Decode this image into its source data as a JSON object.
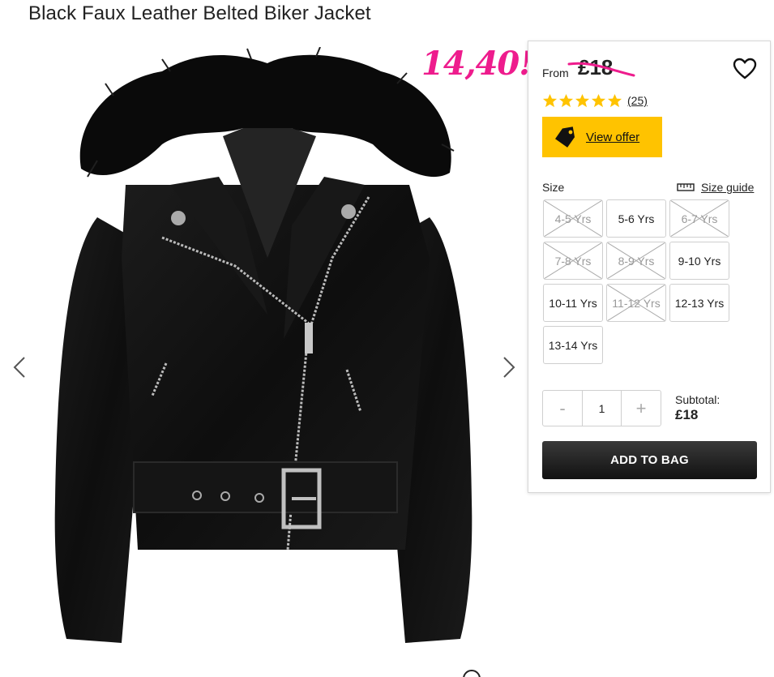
{
  "product": {
    "title": "Black Faux Leather Belted Biker Jacket"
  },
  "promo": {
    "handwritten_price": "14,40!",
    "color": "#ee1c8d"
  },
  "price": {
    "from_label": "From",
    "original": "£18"
  },
  "rating": {
    "stars": 5,
    "count_label": "(25)",
    "star_color": "#ffc300"
  },
  "offer": {
    "label": "View offer",
    "color": "#ffc300",
    "icon": "tag-icon"
  },
  "size_section": {
    "label": "Size",
    "guide_label": "Size guide",
    "guide_icon": "ruler-icon",
    "options": [
      {
        "label": "4-5 Yrs",
        "available": false
      },
      {
        "label": "5-6 Yrs",
        "available": true
      },
      {
        "label": "6-7 Yrs",
        "available": false
      },
      {
        "label": "7-8 Yrs",
        "available": false
      },
      {
        "label": "8-9 Yrs",
        "available": false
      },
      {
        "label": "9-10 Yrs",
        "available": true
      },
      {
        "label": "10-11 Yrs",
        "available": true
      },
      {
        "label": "11-12 Yrs",
        "available": false
      },
      {
        "label": "12-13 Yrs",
        "available": true
      },
      {
        "label": "13-14 Yrs",
        "available": true
      }
    ]
  },
  "quantity": {
    "minus": "-",
    "value": "1",
    "plus": "+"
  },
  "subtotal": {
    "label": "Subtotal:",
    "value": "£18"
  },
  "cart": {
    "add_label": "ADD TO BAG"
  },
  "icons": {
    "prev": "chevron-left-icon",
    "next": "chevron-right-icon",
    "wishlist": "heart-icon",
    "info": "info-icon"
  }
}
